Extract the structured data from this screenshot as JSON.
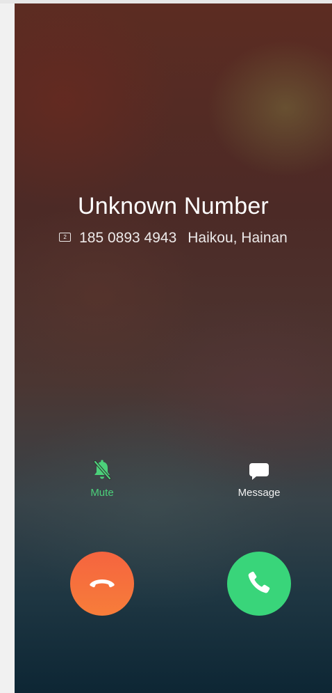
{
  "call": {
    "caller_name": "Unknown Number",
    "sim_label": "2",
    "number": "185 0893 4943",
    "location": "Haikou, Hainan"
  },
  "actions": {
    "mute_label": "Mute",
    "message_label": "Message"
  },
  "colors": {
    "accent_green": "#4cd07a",
    "accept_button": "#39d57a",
    "decline_button": "#f5643f"
  },
  "icons": {
    "sim": "sim-card-icon",
    "mute": "bell-off-icon",
    "message": "chat-bubble-icon",
    "decline": "phone-hangup-icon",
    "accept": "phone-icon"
  }
}
